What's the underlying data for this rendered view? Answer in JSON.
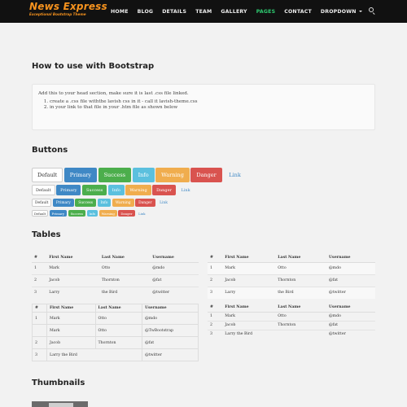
{
  "brand": {
    "title": "News Express",
    "subtitle": "Exceptional Bootstrap Theme"
  },
  "nav": {
    "items": [
      "HOME",
      "BLOG",
      "DETAILS",
      "TEAM",
      "GALLERY",
      "PAGES",
      "CONTACT",
      "DROPDOWN"
    ],
    "active": "PAGES"
  },
  "icons": {
    "search": "search-icon",
    "dropdown": "caret-down-icon"
  },
  "colors": {
    "accent": "#f7931e",
    "active_nav": "#2ecc71",
    "primary": "#3f88c5",
    "success": "#4cae4c",
    "info": "#5bc0de",
    "warning": "#f0ad4e",
    "danger": "#d9534f"
  },
  "howto": {
    "title": "How to use with Bootstrap",
    "intro": "Add this to your head section, make sure it is last .css file linked.",
    "steps": [
      "create a .css file withthe lavish css in it - call it lavish-theme.css",
      "in your link to that file in your .htm file as shown below"
    ]
  },
  "buttons": {
    "title": "Buttons",
    "labels": [
      "Default",
      "Primary",
      "Success",
      "Info",
      "Warning",
      "Danger",
      "Link"
    ]
  },
  "tables": {
    "title": "Tables",
    "headers": [
      "#",
      "First Name",
      "Last Name",
      "Username"
    ],
    "rows": [
      [
        "1",
        "Mark",
        "Otto",
        "@mdo"
      ],
      [
        "2",
        "Jacob",
        "Thornton",
        "@fat"
      ],
      [
        "3",
        "Larry",
        "the Bird",
        "@twitter"
      ]
    ],
    "bordered_rows": [
      [
        "1",
        "Mark",
        "Otto",
        "@mdo"
      ],
      [
        "",
        "Mark",
        "Otto",
        "@TwBootstrap"
      ],
      [
        "2",
        "Jacob",
        "Thornton",
        "@fat"
      ],
      [
        "3",
        "Larry the Bird",
        "",
        "@twitter"
      ]
    ],
    "condensed_rows": [
      [
        "1",
        "Mark",
        "Otto",
        "@mdo"
      ],
      [
        "2",
        "Jacob",
        "Thornton",
        "@fat"
      ],
      [
        "3",
        "Larry the Bird",
        "",
        "@twitter"
      ]
    ]
  },
  "thumbnails": {
    "title": "Thumbnails"
  }
}
